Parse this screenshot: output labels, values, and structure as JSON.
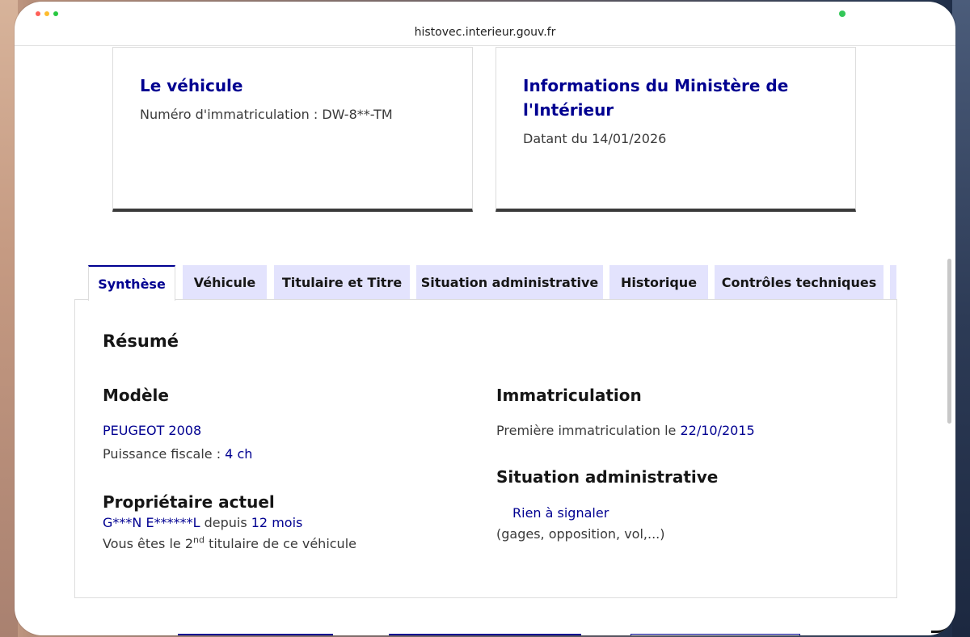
{
  "browser": {
    "url": "histovec.interieur.gouv.fr"
  },
  "cards": [
    {
      "title_lines": [
        "Le véhicule"
      ],
      "line": "Numéro d'immatriculation : DW-8**-TM"
    },
    {
      "title_lines": [
        "Informations du Ministère de",
        "l'Intérieur"
      ],
      "line": "Datant du 14/01/2026"
    }
  ],
  "tabs": [
    {
      "label": "Synthèse",
      "active": true
    },
    {
      "label": "Véhicule",
      "active": false
    },
    {
      "label": "Titulaire et Titre",
      "active": false
    },
    {
      "label": "Situation administrative",
      "active": false
    },
    {
      "label": "Historique",
      "active": false
    },
    {
      "label": "Contrôles techniques",
      "active": false
    }
  ],
  "summary": {
    "heading": "Résumé",
    "model": {
      "heading": "Modèle",
      "name": "PEUGEOT 2008",
      "power_label": "Puissance fiscale :",
      "power_value": "4 ch"
    },
    "owner": {
      "heading": "Propriétaire actuel",
      "name": "G***N E******L",
      "since_label": "depuis",
      "since_value": "12 mois",
      "rank_prefix": "Vous êtes le 2",
      "rank_sup": "nd",
      "rank_suffix": "titulaire de ce véhicule"
    },
    "registration": {
      "heading": "Immatriculation",
      "first_label": "Première immatriculation le",
      "first_date": "22/10/2015"
    },
    "admin": {
      "heading": "Situation administrative",
      "status": "Rien à signaler",
      "details": "(gages, opposition, vol,...)"
    }
  },
  "colors": {
    "accent": "#000091",
    "tab_bg": "#e3e3fd",
    "text": "#3a3a3a"
  }
}
